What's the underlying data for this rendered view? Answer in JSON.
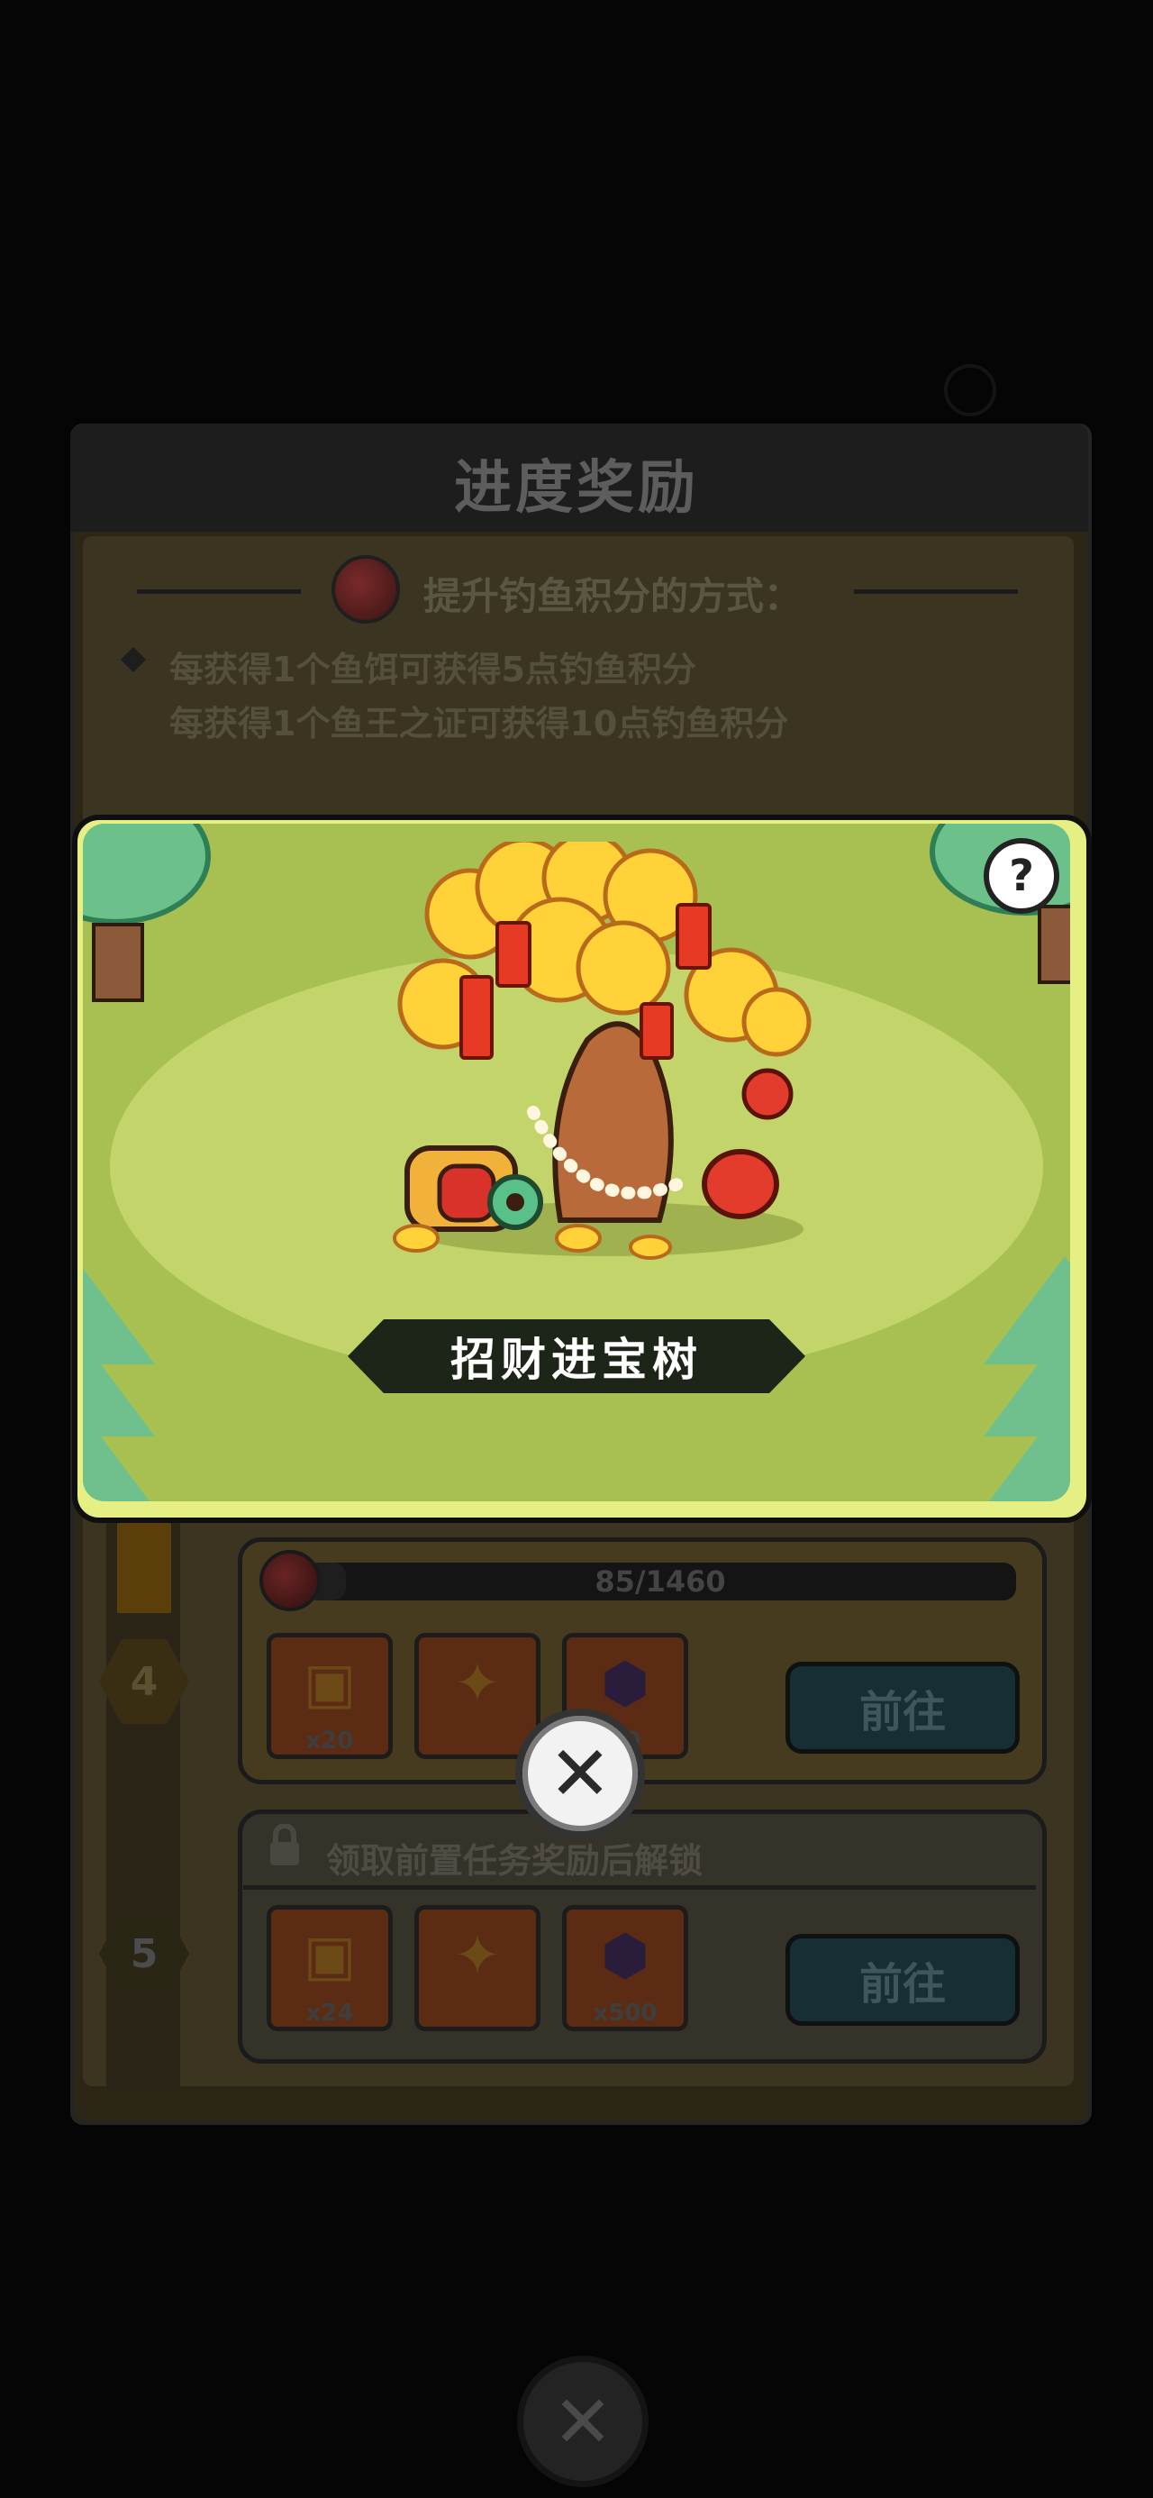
{
  "background_panel": {
    "title": "进度奖励",
    "how_title": "提升钓鱼积分的方式：",
    "rules": [
      "每获得1个鱼饵可获得5点钓鱼积分",
      "每获得1个鱼王之证可获得10点钓鱼积分"
    ],
    "tasks": [
      {
        "level": "4",
        "progress_text": "85/1460",
        "progress_fraction": 0.058,
        "rewards": [
          {
            "icon": "treasure-chest-icon",
            "count": "x20"
          },
          {
            "icon": "gold-ingot-icon",
            "count": ""
          },
          {
            "icon": "purple-gem-icon",
            "count": "x0"
          }
        ],
        "go_label": "前往"
      },
      {
        "level": "5",
        "lock_text": "领取前置任务奖励后解锁",
        "rewards": [
          {
            "icon": "treasure-chest-icon",
            "count": "x24"
          },
          {
            "icon": "gold-ingot-icon",
            "count": ""
          },
          {
            "icon": "purple-gem-icon",
            "count": "x500"
          }
        ],
        "go_label": "前往"
      }
    ]
  },
  "popup": {
    "banner_title": "招财进宝树",
    "help_label": "?",
    "close_label": "✕"
  },
  "colors": {
    "popup_border": "#e6ef84",
    "meadow": "#c3d46a",
    "banner_bg": "#1d2418"
  }
}
